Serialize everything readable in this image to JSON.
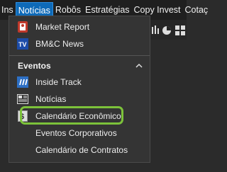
{
  "menubar": {
    "items": [
      {
        "label": "Ins"
      },
      {
        "label": "Notícias"
      },
      {
        "label": "Robôs"
      },
      {
        "label": "Estratégias"
      },
      {
        "label": "Copy Invest"
      },
      {
        "label": "Cotaç"
      }
    ],
    "active": "Notícias"
  },
  "dropdown": {
    "items_top": [
      {
        "label": "Market Report",
        "icon": "market-report-icon"
      },
      {
        "label": "BM&C News",
        "icon": "tv-icon"
      }
    ],
    "section": {
      "title": "Eventos",
      "collapse_icon": "chevron-up-icon"
    },
    "items_events": [
      {
        "label": "Inside Track",
        "icon": "inside-track-icon"
      },
      {
        "label": "Notícias",
        "icon": "newspaper-icon"
      },
      {
        "label": "Calendário Econômico",
        "icon": "dollar-calendar-icon",
        "highlighted": true
      },
      {
        "label": "Eventos Corporativos"
      },
      {
        "label": "Calendário de Contratos"
      }
    ],
    "tv_badge": "TV"
  },
  "colors": {
    "highlight": "#7cc23a",
    "active_menu": "#0e6ab8"
  }
}
